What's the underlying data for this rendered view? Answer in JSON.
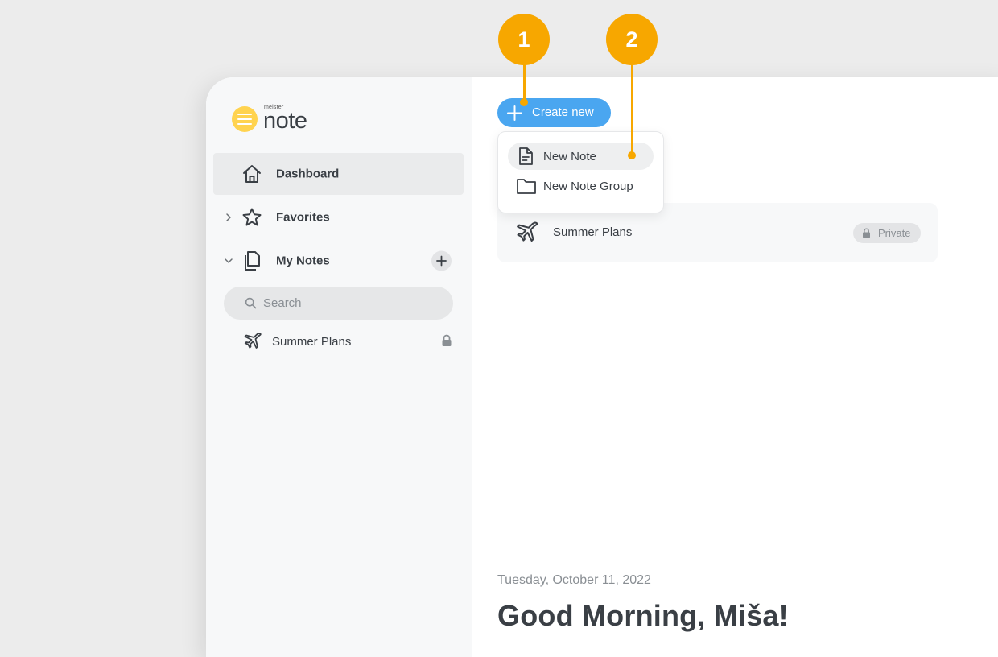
{
  "logo": {
    "small": "meister",
    "name": "note"
  },
  "sidebar": {
    "items": [
      {
        "label": "Dashboard",
        "icon": "home-icon"
      },
      {
        "label": "Favorites",
        "icon": "star-icon"
      },
      {
        "label": "My Notes",
        "icon": "notes-icon"
      }
    ],
    "search": {
      "placeholder": "Search"
    },
    "notes": [
      {
        "title": "Summer Plans",
        "icon": "airplane-icon",
        "locked": true
      }
    ]
  },
  "main": {
    "create_button": "Create new",
    "menu": [
      {
        "label": "New Note",
        "icon": "document-icon"
      },
      {
        "label": "New Note Group",
        "icon": "folder-icon"
      }
    ],
    "note_card": {
      "title": "Summer Plans",
      "badge": "Private"
    },
    "date": "Tuesday, October 11, 2022",
    "greeting": "Good Morning, Miša!"
  },
  "callouts": [
    "1",
    "2"
  ],
  "colors": {
    "accent": "#4aa6f0",
    "callout": "#f7a700",
    "logo": "#ffd34f"
  }
}
